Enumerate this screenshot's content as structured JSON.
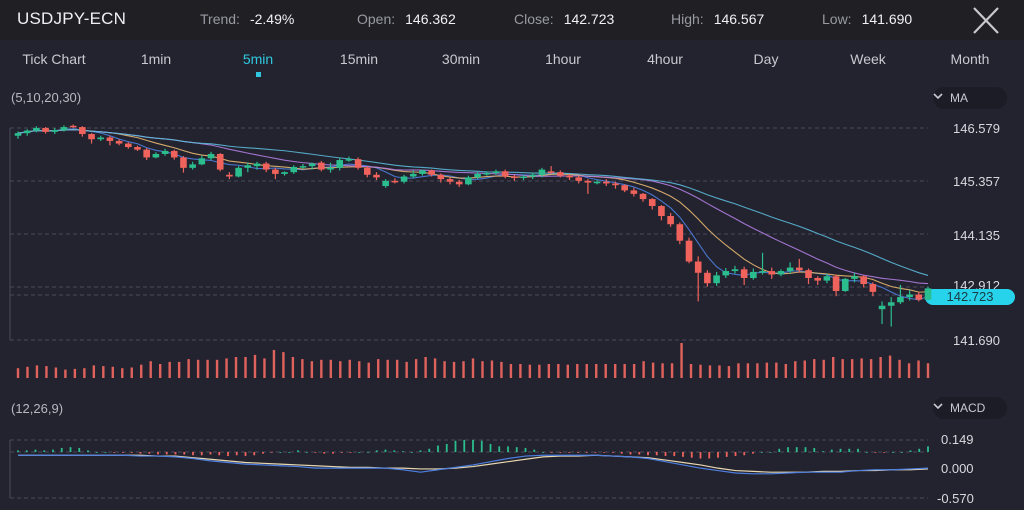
{
  "header": {
    "symbol": "USDJPY-ECN",
    "stats": [
      {
        "label": "Trend:",
        "value": "-2.49%"
      },
      {
        "label": "Open:",
        "value": "146.362"
      },
      {
        "label": "Close:",
        "value": "142.723"
      },
      {
        "label": "High:",
        "value": "146.567"
      },
      {
        "label": "Low:",
        "value": "141.690"
      }
    ],
    "close_icon": "close-icon"
  },
  "timeframes": {
    "items": [
      "Tick Chart",
      "1min",
      "5min",
      "15min",
      "30min",
      "1hour",
      "4hour",
      "Day",
      "Week",
      "Month"
    ],
    "active": "5min"
  },
  "main_indicator": {
    "params": "(5,10,20,30)",
    "selector": "MA"
  },
  "sub_indicator": {
    "params": "(12,26,9)",
    "selector": "MACD"
  },
  "colors": {
    "up": "#2bbd8e",
    "down": "#f0635c",
    "accent": "#2fc8e0",
    "ma5": "#4d7fe0",
    "ma10": "#e8b870",
    "ma20": "#b07de0",
    "ma30": "#5ab8d8"
  },
  "chart_data": [
    {
      "type": "candlestick",
      "title": "USDJPY-ECN 5min",
      "indicator": "MA(5,10,20,30)",
      "y_ticks": [
        "146.579",
        "145.357",
        "144.135",
        "142.912",
        "141.690"
      ],
      "ylim": [
        141.69,
        146.579
      ],
      "current_price": "142.723",
      "grid": true,
      "candles": [
        [
          146.4,
          146.5,
          146.33,
          146.46
        ],
        [
          146.46,
          146.55,
          146.4,
          146.52
        ],
        [
          146.52,
          146.62,
          146.48,
          146.58
        ],
        [
          146.58,
          146.6,
          146.45,
          146.49
        ],
        [
          146.49,
          146.58,
          146.44,
          146.53
        ],
        [
          146.53,
          146.64,
          146.5,
          146.6
        ],
        [
          146.63,
          146.66,
          146.58,
          146.6
        ],
        [
          146.6,
          146.62,
          146.38,
          146.44
        ],
        [
          146.44,
          146.46,
          146.22,
          146.32
        ],
        [
          146.32,
          146.4,
          146.28,
          146.36
        ],
        [
          146.36,
          146.4,
          146.18,
          146.28
        ],
        [
          146.28,
          146.32,
          146.18,
          146.22
        ],
        [
          146.22,
          146.25,
          146.1,
          146.14
        ],
        [
          146.14,
          146.17,
          146.05,
          146.08
        ],
        [
          146.08,
          146.12,
          145.84,
          145.9
        ],
        [
          145.9,
          146.02,
          145.88,
          145.98
        ],
        [
          145.98,
          146.1,
          145.94,
          146.05
        ],
        [
          146.05,
          146.08,
          145.85,
          145.9
        ],
        [
          145.9,
          145.93,
          145.55,
          145.66
        ],
        [
          145.66,
          145.8,
          145.62,
          145.74
        ],
        [
          145.74,
          145.94,
          145.72,
          145.88
        ],
        [
          145.88,
          146.03,
          145.84,
          145.98
        ],
        [
          145.98,
          146.0,
          145.58,
          145.62
        ],
        [
          145.5,
          145.56,
          145.4,
          145.46
        ],
        [
          145.46,
          145.7,
          145.44,
          145.66
        ],
        [
          145.66,
          145.78,
          145.56,
          145.72
        ],
        [
          145.7,
          145.8,
          145.62,
          145.76
        ],
        [
          145.76,
          145.8,
          145.56,
          145.62
        ],
        [
          145.62,
          145.66,
          145.4,
          145.52
        ],
        [
          145.52,
          145.58,
          145.48,
          145.56
        ],
        [
          145.56,
          145.72,
          145.52,
          145.68
        ],
        [
          145.68,
          145.75,
          145.64,
          145.7
        ],
        [
          145.7,
          145.78,
          145.62,
          145.76
        ],
        [
          145.78,
          145.82,
          145.58,
          145.62
        ],
        [
          145.62,
          145.78,
          145.55,
          145.66
        ],
        [
          145.66,
          145.9,
          145.6,
          145.84
        ],
        [
          145.84,
          145.92,
          145.8,
          145.86
        ],
        [
          145.86,
          145.9,
          145.62,
          145.66
        ],
        [
          145.66,
          145.7,
          145.44,
          145.5
        ],
        [
          145.5,
          145.56,
          145.38,
          145.44
        ],
        [
          145.24,
          145.4,
          145.2,
          145.36
        ],
        [
          145.36,
          145.42,
          145.3,
          145.34
        ],
        [
          145.34,
          145.5,
          145.3,
          145.46
        ],
        [
          145.46,
          145.6,
          145.42,
          145.52
        ],
        [
          145.52,
          145.62,
          145.48,
          145.6
        ],
        [
          145.6,
          145.62,
          145.46,
          145.5
        ],
        [
          145.5,
          145.53,
          145.32,
          145.4
        ],
        [
          145.4,
          145.44,
          145.28,
          145.34
        ],
        [
          145.34,
          145.38,
          145.22,
          145.28
        ],
        [
          145.28,
          145.48,
          145.26,
          145.44
        ],
        [
          145.44,
          145.56,
          145.4,
          145.52
        ],
        [
          145.52,
          145.58,
          145.48,
          145.54
        ],
        [
          145.54,
          145.62,
          145.5,
          145.58
        ],
        [
          145.58,
          145.62,
          145.42,
          145.46
        ],
        [
          145.46,
          145.5,
          145.36,
          145.44
        ],
        [
          145.44,
          145.5,
          145.38,
          145.46
        ],
        [
          145.46,
          145.55,
          145.4,
          145.5
        ],
        [
          145.5,
          145.66,
          145.44,
          145.62
        ],
        [
          145.58,
          145.7,
          145.52,
          145.56
        ],
        [
          145.56,
          145.6,
          145.44,
          145.48
        ],
        [
          145.48,
          145.52,
          145.38,
          145.44
        ],
        [
          145.44,
          145.48,
          145.3,
          145.36
        ],
        [
          145.36,
          145.4,
          145.06,
          145.32
        ],
        [
          145.32,
          145.38,
          145.28,
          145.34
        ],
        [
          145.34,
          145.4,
          145.24,
          145.3
        ],
        [
          145.3,
          145.34,
          145.18,
          145.26
        ],
        [
          145.26,
          145.28,
          145.1,
          145.14
        ],
        [
          145.14,
          145.2,
          145.0,
          145.06
        ],
        [
          145.06,
          145.08,
          144.88,
          144.94
        ],
        [
          144.94,
          144.96,
          144.7,
          144.78
        ],
        [
          144.78,
          144.8,
          144.45,
          144.55
        ],
        [
          144.55,
          144.62,
          144.3,
          144.36
        ],
        [
          144.36,
          144.4,
          143.9,
          143.98
        ],
        [
          143.98,
          144.05,
          143.46,
          143.5
        ],
        [
          143.5,
          143.62,
          142.58,
          143.24
        ],
        [
          143.24,
          143.3,
          142.92,
          143.0
        ],
        [
          143.0,
          143.26,
          142.94,
          143.18
        ],
        [
          143.18,
          143.35,
          143.12,
          143.28
        ],
        [
          143.28,
          143.4,
          143.22,
          143.32
        ],
        [
          143.32,
          143.38,
          142.96,
          143.12
        ],
        [
          143.12,
          143.34,
          143.08,
          143.26
        ],
        [
          143.26,
          143.7,
          143.2,
          143.28
        ],
        [
          143.28,
          143.36,
          143.1,
          143.2
        ],
        [
          143.2,
          143.32,
          143.16,
          143.28
        ],
        [
          143.28,
          143.48,
          143.22,
          143.36
        ],
        [
          143.36,
          143.56,
          143.24,
          143.3
        ],
        [
          143.3,
          143.34,
          142.98,
          143.12
        ],
        [
          143.12,
          143.16,
          142.96,
          143.06
        ],
        [
          143.06,
          143.22,
          143.0,
          143.16
        ],
        [
          143.16,
          143.2,
          142.7,
          142.82
        ],
        [
          142.82,
          143.12,
          142.8,
          143.1
        ],
        [
          143.1,
          143.24,
          143.02,
          143.16
        ],
        [
          143.16,
          143.18,
          142.9,
          142.98
        ],
        [
          142.98,
          143.02,
          142.7,
          142.8
        ],
        [
          142.4,
          142.58,
          142.06,
          142.48
        ],
        [
          142.48,
          142.68,
          142.0,
          142.56
        ],
        [
          142.56,
          142.96,
          142.52,
          142.68
        ],
        [
          142.68,
          142.84,
          142.6,
          142.74
        ],
        [
          142.74,
          142.8,
          142.58,
          142.62
        ],
        [
          142.62,
          142.92,
          142.6,
          142.88
        ]
      ],
      "volume": [
        28,
        32,
        36,
        34,
        30,
        24,
        26,
        28,
        36,
        34,
        32,
        28,
        30,
        38,
        48,
        40,
        46,
        46,
        54,
        52,
        52,
        52,
        56,
        60,
        60,
        66,
        56,
        80,
        74,
        60,
        54,
        48,
        52,
        52,
        48,
        52,
        48,
        44,
        54,
        52,
        52,
        46,
        54,
        60,
        56,
        48,
        46,
        48,
        56,
        48,
        50,
        46,
        40,
        40,
        38,
        38,
        40,
        40,
        38,
        40,
        40,
        40,
        40,
        40,
        40,
        40,
        48,
        44,
        42,
        42,
        100,
        40,
        38,
        36,
        36,
        34,
        42,
        42,
        42,
        44,
        44,
        40,
        48,
        50,
        54,
        52,
        60,
        54,
        54,
        56,
        54,
        60,
        64,
        52,
        42,
        50,
        42
      ]
    },
    {
      "type": "bar+line",
      "title": "MACD(12,26,9)",
      "y_ticks": [
        "0.149",
        "0.000",
        "-0.570"
      ],
      "ylim": [
        -0.57,
        0.149
      ],
      "histogram": [
        0.02,
        0.02,
        0.03,
        0.02,
        0.03,
        0.05,
        0.06,
        0.05,
        0.02,
        0.0,
        0.0,
        -0.01,
        -0.01,
        -0.01,
        -0.02,
        -0.02,
        -0.03,
        -0.03,
        -0.03,
        -0.03,
        -0.04,
        -0.04,
        -0.03,
        -0.04,
        -0.05,
        -0.04,
        -0.05,
        -0.04,
        -0.02,
        -0.01,
        0.0,
        0.0,
        0.02,
        0.0,
        -0.01,
        -0.02,
        -0.02,
        -0.01,
        -0.01,
        0.0,
        0.0,
        0.02,
        0.03,
        0.02,
        0.01,
        0.0,
        0.02,
        0.04,
        0.08,
        0.1,
        0.14,
        0.15,
        0.15,
        0.14,
        0.1,
        0.07,
        0.07,
        0.06,
        0.05,
        0.03,
        0.0,
        -0.01,
        -0.01,
        -0.01,
        -0.01,
        -0.01,
        -0.01,
        -0.01,
        -0.01,
        -0.02,
        -0.03,
        -0.03,
        -0.04,
        -0.04,
        -0.05,
        -0.05,
        -0.06,
        -0.07,
        -0.08,
        -0.08,
        -0.07,
        -0.06,
        -0.05,
        -0.04,
        -0.02,
        0.0,
        0.0,
        0.04,
        0.06,
        0.06,
        0.06,
        0.05,
        0.01,
        0.03,
        0.04,
        0.04,
        0.04,
        0.0,
        -0.01,
        -0.01,
        0.0,
        0.0,
        0.02,
        0.04,
        0.07
      ],
      "dif": [
        -0.04,
        -0.04,
        -0.04,
        -0.04,
        -0.04,
        -0.04,
        -0.04,
        -0.05,
        -0.05,
        -0.06,
        -0.08,
        -0.11,
        -0.13,
        -0.15,
        -0.16,
        -0.17,
        -0.18,
        -0.2,
        -0.2,
        -0.2,
        -0.2,
        -0.2,
        -0.22,
        -0.25,
        -0.22,
        -0.19,
        -0.16,
        -0.12,
        -0.08,
        -0.05,
        -0.04,
        -0.04,
        -0.04,
        -0.04,
        -0.05,
        -0.06,
        -0.08,
        -0.12,
        -0.16,
        -0.2,
        -0.23,
        -0.26,
        -0.27,
        -0.27,
        -0.26,
        -0.25,
        -0.25,
        -0.25,
        -0.23,
        -0.22,
        -0.22,
        -0.21,
        -0.2
      ],
      "dea": [
        -0.04,
        -0.04,
        -0.04,
        -0.04,
        -0.04,
        -0.04,
        -0.04,
        -0.04,
        -0.05,
        -0.05,
        -0.07,
        -0.09,
        -0.11,
        -0.13,
        -0.14,
        -0.15,
        -0.16,
        -0.17,
        -0.18,
        -0.19,
        -0.19,
        -0.2,
        -0.2,
        -0.21,
        -0.21,
        -0.2,
        -0.18,
        -0.15,
        -0.12,
        -0.09,
        -0.06,
        -0.05,
        -0.05,
        -0.04,
        -0.05,
        -0.06,
        -0.07,
        -0.1,
        -0.13,
        -0.16,
        -0.2,
        -0.23,
        -0.24,
        -0.25,
        -0.25,
        -0.25,
        -0.24,
        -0.24,
        -0.23,
        -0.23,
        -0.22,
        -0.22,
        -0.21
      ]
    }
  ]
}
